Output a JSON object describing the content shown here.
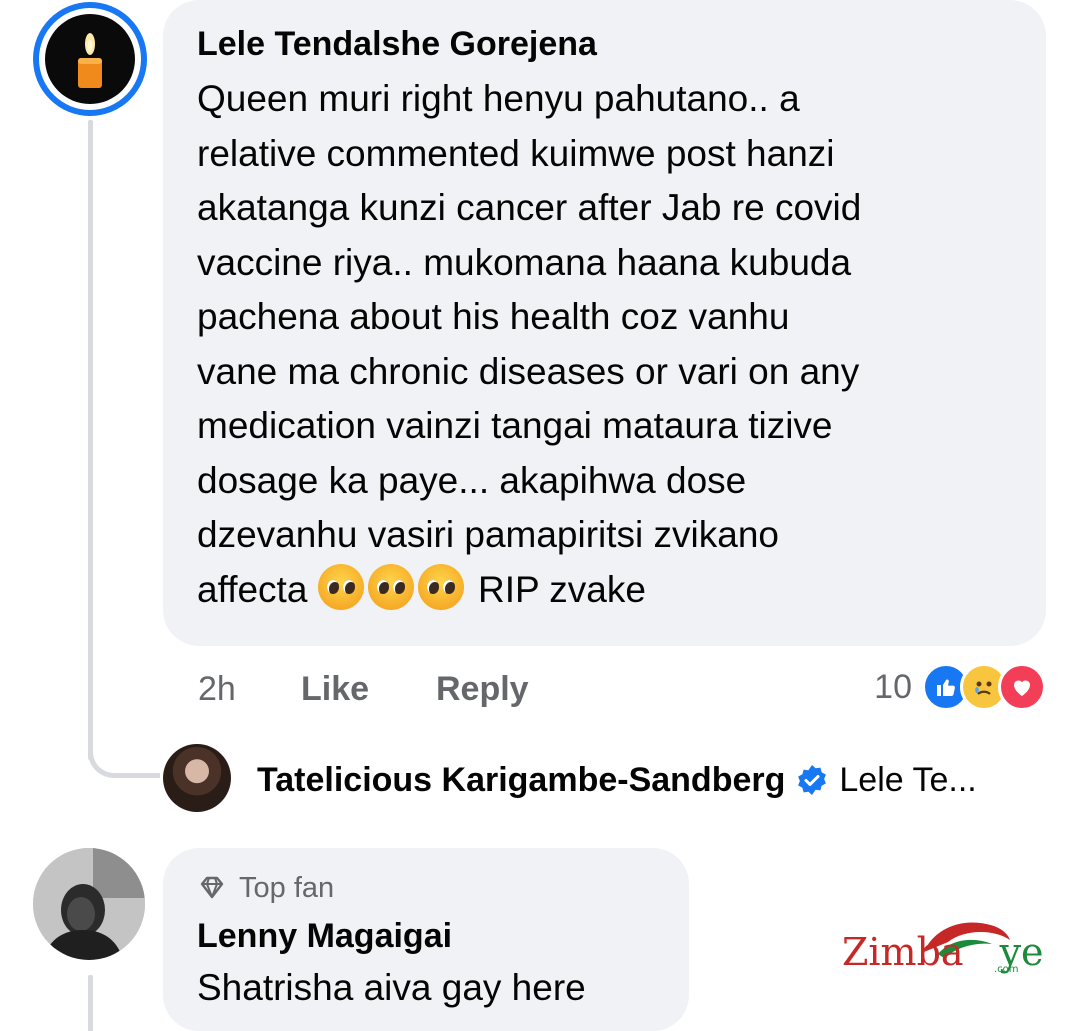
{
  "comments": [
    {
      "author": "Lele Tendalshe Gorejena",
      "text_lines": [
        "Queen muri right henyu pahutano.. a",
        "relative commented kuimwe post hanzi",
        "akatanga kunzi cancer after Jab re covid",
        "vaccine riya.. mukomana haana kubuda",
        "pachena about his health coz vanhu",
        "vane ma chronic diseases or vari on any",
        "medication vainzi tangai mataura tizive",
        "dosage ka paye... akapihwa dose",
        "dzevanhu vasiri pamapiritsi zvikano"
      ],
      "last_line_prefix": "affecta ",
      "last_line_emojis": [
        "pleading-face-emoji",
        "pleading-face-emoji",
        "pleading-face-emoji"
      ],
      "last_line_suffix": " RIP zvake",
      "time": "2h",
      "like_label": "Like",
      "reply_label": "Reply",
      "reaction_count": "10",
      "reactions": [
        "like",
        "sad",
        "love"
      ]
    },
    {
      "badge": "Top fan",
      "author": "Lenny Magaigai",
      "text": "Shatrisha aiva gay here"
    }
  ],
  "reply_preview": {
    "author": "Tatelicious Karigambe-Sandberg",
    "preview": "Lele Te..."
  },
  "watermark": {
    "text_red": "Zimba",
    "text_green": "ye",
    "domain": ".com"
  },
  "colors": {
    "accent": "#1877f2",
    "bubble": "#f0f2f5",
    "muted_text": "#65676b",
    "love": "#f33e58",
    "sad": "#f7c53e"
  }
}
